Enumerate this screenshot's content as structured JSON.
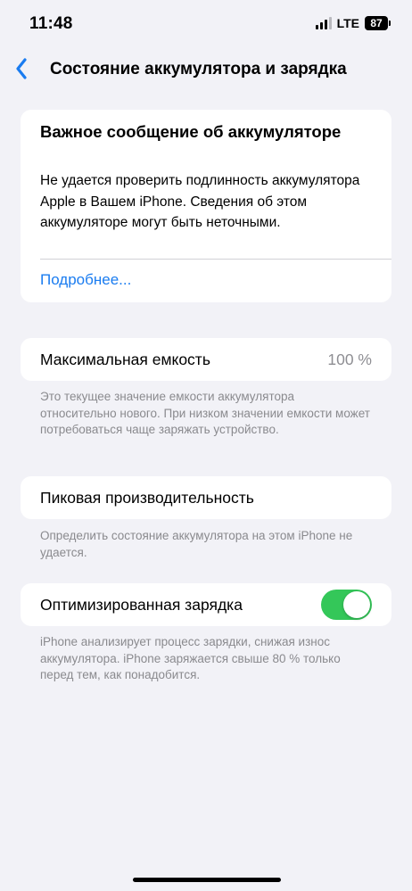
{
  "status_bar": {
    "time": "11:48",
    "network": "LTE",
    "battery_level": "87"
  },
  "nav": {
    "back_icon": "chevron-left-icon",
    "title": "Состояние аккумулятора и зарядка"
  },
  "alert": {
    "title": "Важное сообщение об аккумуляторе",
    "body": "Не удается проверить подлинность аккумулятора Apple в Вашем iPhone. Сведения об этом аккумуляторе могут быть неточными.",
    "link": "Подробнее..."
  },
  "max_capacity": {
    "label": "Максимальная емкость",
    "value": "100 %",
    "footnote": "Это текущее значение емкости аккумулятора относительно нового. При низком значении емкости может потребоваться чаще заряжать устройство."
  },
  "peak_performance": {
    "label": "Пиковая производительность",
    "footnote": "Определить состояние аккумулятора на этом iPhone не удается."
  },
  "optimized_charging": {
    "label": "Оптимизированная зарядка",
    "enabled": true,
    "footnote": "iPhone анализирует процесс зарядки, снижая износ аккумулятора. iPhone заряжается свыше 80 % только перед тем, как понадобится."
  },
  "colors": {
    "accent": "#1a7cf0",
    "toggle_on": "#34c759",
    "background": "#f2f2f7"
  }
}
